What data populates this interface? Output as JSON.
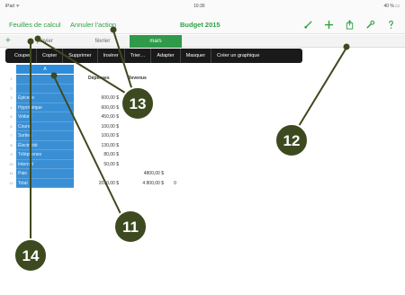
{
  "status": {
    "left": "iPad ᯤ",
    "time": "10:30",
    "battery": "40 % ▭"
  },
  "nav": {
    "sheets_link": "Feuilles de calcul",
    "undo_link": "Annuler l'action",
    "doc_title": "Budget 2015",
    "icons": [
      "brush-icon",
      "plus-icon",
      "share-icon",
      "wrench-icon",
      "help-icon"
    ]
  },
  "tabs": {
    "add": "+",
    "items": [
      "janvier",
      "février",
      "mars"
    ],
    "active": "mars"
  },
  "context_menu": [
    "Couper",
    "Copier",
    "Supprimer",
    "Insérer",
    "Trier…",
    "Adapter",
    "Masquer",
    "Créer un graphique"
  ],
  "sheet": {
    "column_label": "A",
    "headers": {
      "b": "Dépenses",
      "c": "Revenus"
    },
    "rows": [
      {
        "n": "1",
        "a": "",
        "b": "",
        "c": "",
        "d": ""
      },
      {
        "n": "2",
        "a": "",
        "b": "",
        "c": "",
        "d": ""
      },
      {
        "n": "3",
        "a": "Épicerie",
        "b": "600,00 $",
        "c": "",
        "d": ""
      },
      {
        "n": "4",
        "a": "Hypothèque",
        "b": "600,00 $",
        "c": "",
        "d": ""
      },
      {
        "n": "5",
        "a": "Voiture",
        "b": "450,00 $",
        "c": "",
        "d": ""
      },
      {
        "n": "6",
        "a": "Cours",
        "b": "100,00 $",
        "c": "",
        "d": ""
      },
      {
        "n": "7",
        "a": "Sorties",
        "b": "100,00 $",
        "c": "",
        "d": ""
      },
      {
        "n": "8",
        "a": "Électricité",
        "b": "130,00 $",
        "c": "",
        "d": ""
      },
      {
        "n": "9",
        "a": "Téléphones",
        "b": "80,00 $",
        "c": "",
        "d": ""
      },
      {
        "n": "10",
        "a": "Internet",
        "b": "50,00 $",
        "c": "",
        "d": ""
      },
      {
        "n": "11",
        "a": "Paie",
        "b": "",
        "c": "4800,00 $",
        "d": ""
      },
      {
        "n": "12",
        "a": "Total",
        "b": "2010,00 $",
        "c": "4 800,00 $",
        "d": "0"
      }
    ]
  },
  "callouts": {
    "c11": "11",
    "c12": "12",
    "c13": "13",
    "c14": "14"
  },
  "colors": {
    "accent": "#2f9f45",
    "selection": "#3a8fd4",
    "callout": "#3d4a1f"
  }
}
